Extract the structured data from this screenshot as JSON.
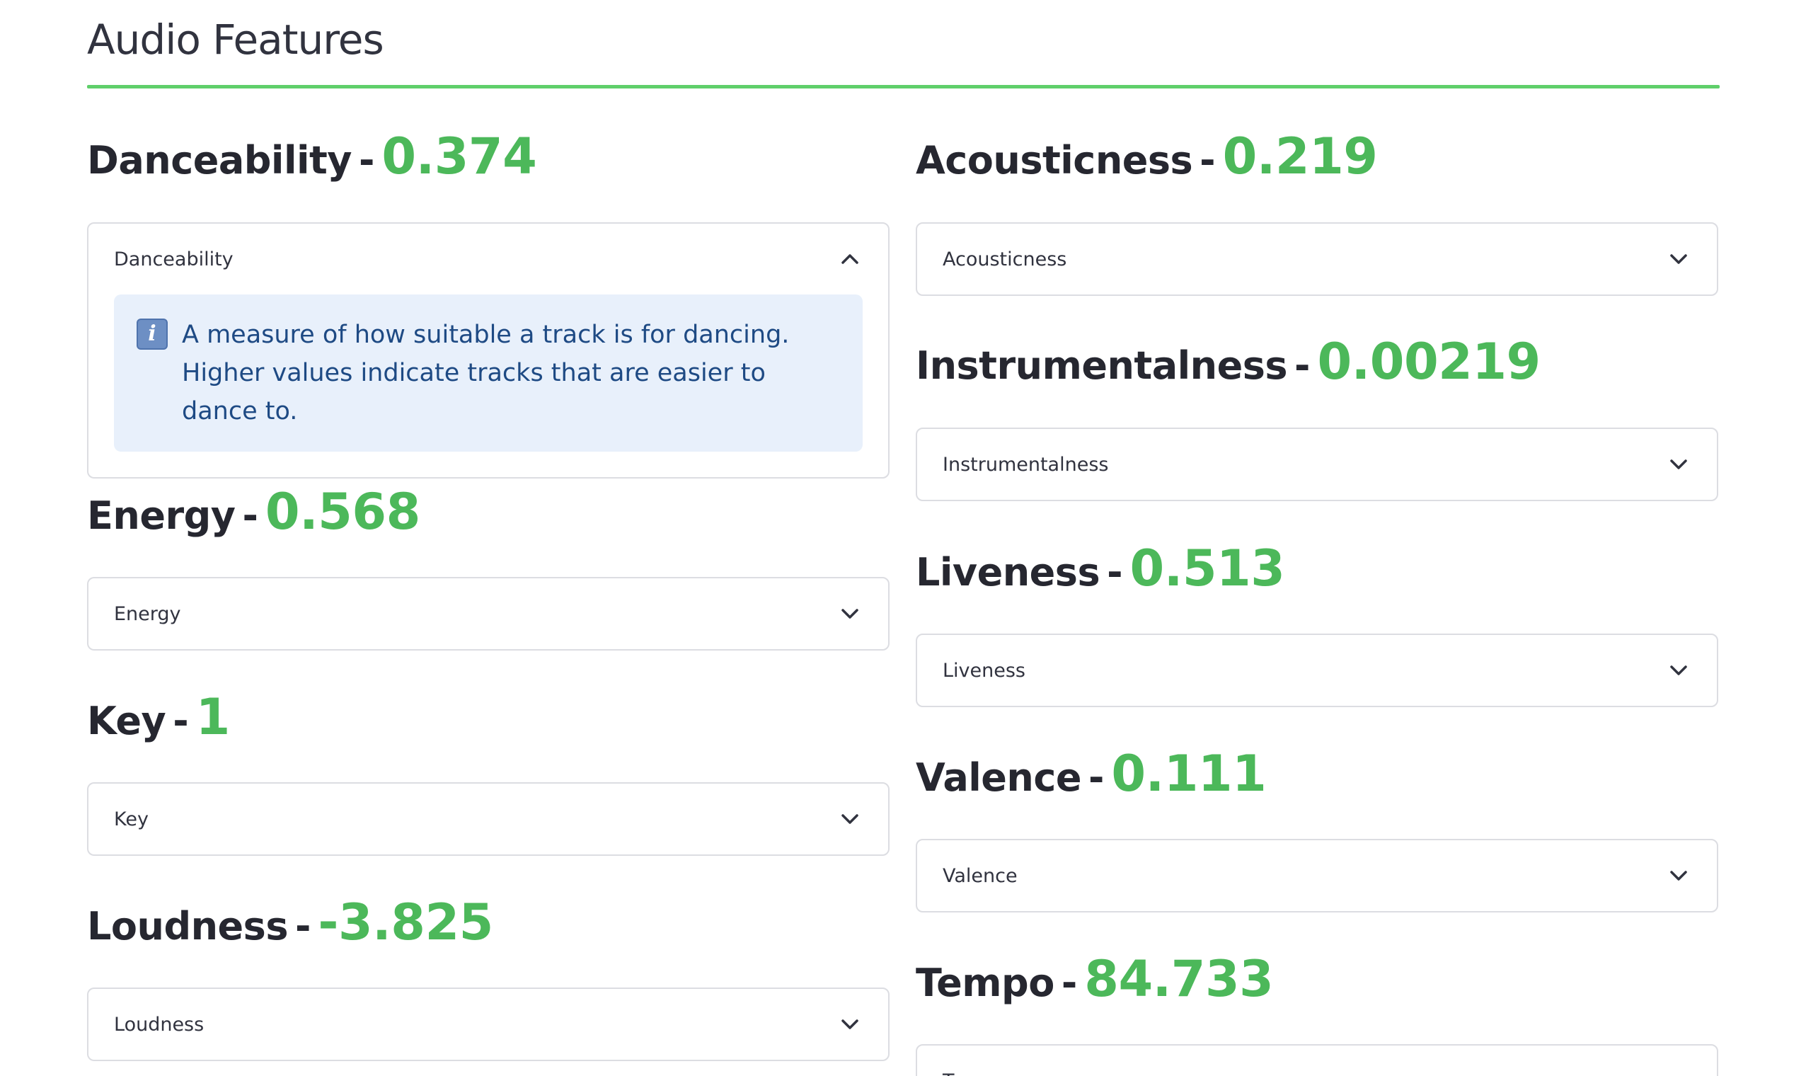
{
  "section": {
    "title": "Audio Features"
  },
  "separator": "-",
  "colors": {
    "accent": "#4cb85a",
    "divider": "#5fcf6a",
    "info_background": "#e8f0fb",
    "info_text": "#1e4a84"
  },
  "left_column": [
    {
      "name": "Danceability",
      "value": "0.374",
      "expander_label": "Danceability",
      "expanded": true,
      "description": "A measure of how suitable a track is for dancing. Higher values indicate tracks that are easier to dance to.",
      "icon": "chevron-up-icon"
    },
    {
      "name": "Energy",
      "value": "0.568",
      "expander_label": "Energy",
      "expanded": false,
      "icon": "chevron-down-icon"
    },
    {
      "name": "Key",
      "value": "1",
      "expander_label": "Key",
      "expanded": false,
      "icon": "chevron-down-icon"
    },
    {
      "name": "Loudness",
      "value": "-3.825",
      "expander_label": "Loudness",
      "expanded": false,
      "icon": "chevron-down-icon"
    }
  ],
  "right_column": [
    {
      "name": "Acousticness",
      "value": "0.219",
      "expander_label": "Acousticness",
      "expanded": false,
      "icon": "chevron-down-icon"
    },
    {
      "name": "Instrumentalness",
      "value": "0.00219",
      "expander_label": "Instrumentalness",
      "expanded": false,
      "icon": "chevron-down-icon"
    },
    {
      "name": "Liveness",
      "value": "0.513",
      "expander_label": "Liveness",
      "expanded": false,
      "icon": "chevron-down-icon"
    },
    {
      "name": "Valence",
      "value": "0.111",
      "expander_label": "Valence",
      "expanded": false,
      "icon": "chevron-down-icon"
    },
    {
      "name": "Tempo",
      "value": "84.733",
      "expander_label": "Tempo",
      "expanded": false,
      "icon": "chevron-down-icon"
    }
  ]
}
